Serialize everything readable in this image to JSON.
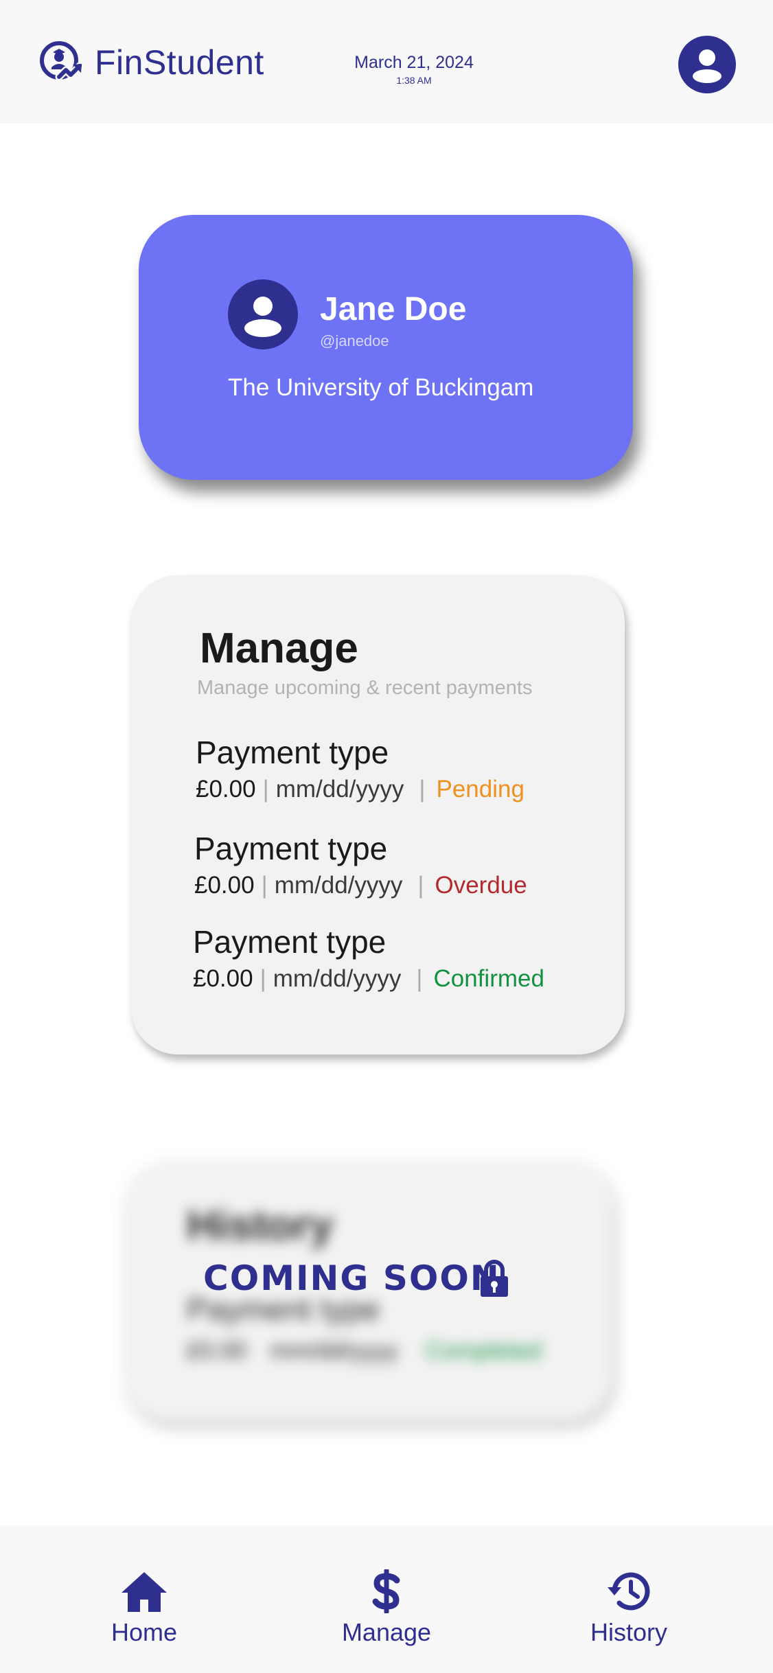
{
  "app": {
    "brand": "FinStudent",
    "date": "March 21, 2024",
    "time": "1:38 AM",
    "accent_color": "#2e2f8e",
    "card_color": "#6e72f4",
    "logo_icon": "graduate-growth-icon",
    "header_avatar_icon": "user-avatar-icon"
  },
  "profile": {
    "name": "Jane Doe",
    "handle": "@janedoe",
    "university": "The University of Buckingam",
    "avatar_icon": "user-avatar-icon"
  },
  "manage": {
    "title": "Manage",
    "subtitle": "Manage upcoming & recent payments",
    "payments": [
      {
        "type": "Payment type",
        "amount": "£0.00",
        "separator": "|",
        "date": "mm/dd/yyyy",
        "status": "Pending",
        "status_color": "#f0901e"
      },
      {
        "type": "Payment type",
        "amount": "£0.00",
        "separator": "|",
        "date": "mm/dd/yyyy",
        "status": "Overdue",
        "status_color": "#b22a2e"
      },
      {
        "type": "Payment type",
        "amount": "£0.00",
        "separator": "|",
        "date": "mm/dd/yyyy",
        "status": "Confirmed",
        "status_color": "#12913f"
      }
    ]
  },
  "history": {
    "title": "History",
    "payment_type": "Payment type",
    "amount": "£0.00",
    "date": "mm/dd/yyyy",
    "status": "Completed",
    "overlay_text": "COMING SOON",
    "lock_icon": "lock-icon"
  },
  "nav": {
    "items": [
      {
        "label": "Home",
        "icon": "home-icon"
      },
      {
        "label": "Manage",
        "icon": "dollar-icon"
      },
      {
        "label": "History",
        "icon": "history-icon"
      }
    ]
  }
}
